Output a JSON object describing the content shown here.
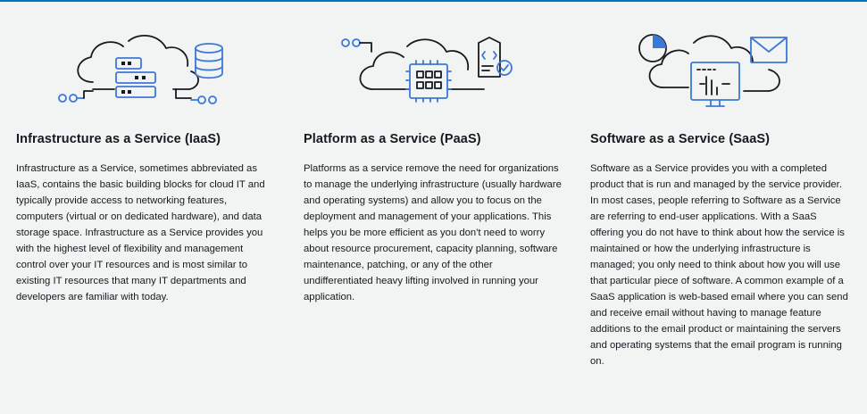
{
  "accent_color": "#0073bb",
  "icon_blue": "#3b78d8",
  "cards": [
    {
      "icon": "server-database-cloud-icon",
      "title": "Infrastructure as a Service (IaaS)",
      "description": "Infrastructure as a Service, sometimes abbreviated as IaaS, contains the basic building blocks for cloud IT and typically provide access to networking features, computers (virtual or on dedicated hardware), and data storage space. Infrastructure as a Service provides you with the highest level of flexibility and management control over your IT resources and is most similar to existing IT resources that many IT departments and developers are familiar with today."
    },
    {
      "icon": "chip-cloud-icon",
      "title": "Platform as a Service (PaaS)",
      "description": "Platforms as a service remove the need for organizations to manage the underlying infrastructure (usually hardware and operating systems) and allow you to focus on the deployment and management of your applications. This helps you be more efficient as you don't need to worry about resource procurement, capacity planning, software maintenance, patching, or any of the other undifferentiated heavy lifting involved in running your application."
    },
    {
      "icon": "monitor-email-cloud-icon",
      "title": "Software as a Service (SaaS)",
      "description": "Software as a Service provides you with a completed product that is run and managed by the service provider. In most cases, people referring to Software as a Service are referring to end-user applications. With a SaaS offering you do not have to think about how the service is maintained or how the underlying infrastructure is managed; you only need to think about how you will use that particular piece of software. A common example of a SaaS application is web-based email where you can send and receive email without having to manage feature additions to the email product or maintaining the servers and operating systems that the email program is running on."
    }
  ]
}
